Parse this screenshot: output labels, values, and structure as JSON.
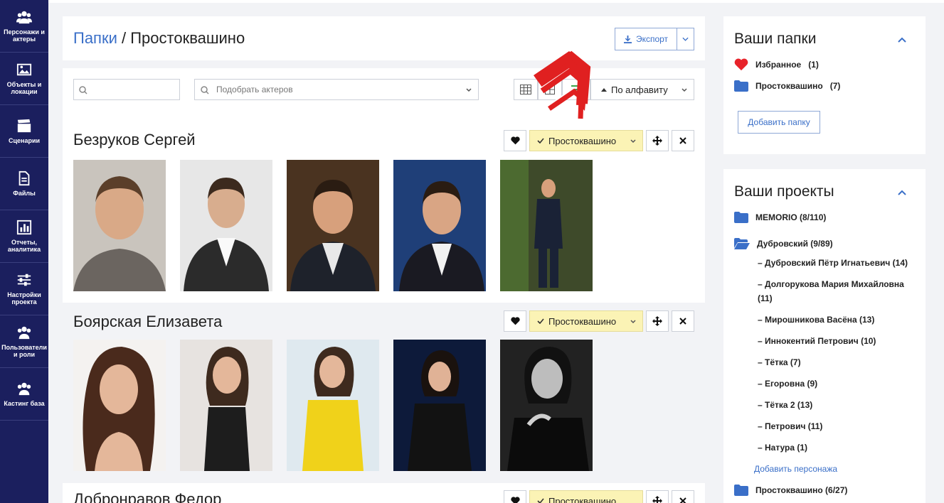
{
  "sidebar": {
    "items": [
      {
        "label": "Персонажи и актеры",
        "icon": "users-icon"
      },
      {
        "label": "Объекты и локации",
        "icon": "image-icon"
      },
      {
        "label": "Сценарии",
        "icon": "clapperboard-icon"
      },
      {
        "label": "Файлы",
        "icon": "file-icon"
      },
      {
        "label": "Отчеты, аналитика",
        "icon": "chart-icon"
      },
      {
        "label": "Настройки проекта",
        "icon": "sliders-icon"
      },
      {
        "label": "Пользователи и роли",
        "icon": "users-icon"
      },
      {
        "label": "Кастинг база",
        "icon": "users-icon"
      }
    ]
  },
  "header": {
    "breadcrumb_link": "Папки",
    "separator": " / ",
    "current": "Простоквашино",
    "export_label": "Экспорт"
  },
  "toolbar": {
    "actor_placeholder": "Подобрать актеров",
    "sort_label": "По алфавиту"
  },
  "actors": [
    {
      "name": "Безруков Сергей",
      "folder": "Простоквашино"
    },
    {
      "name": "Боярская Елизавета",
      "folder": "Простоквашино"
    },
    {
      "name": "Добронравов Федор",
      "folder": "Простоквашино"
    }
  ],
  "folders_panel": {
    "title": "Ваши папки",
    "items": [
      {
        "name": "Избранное",
        "count": "(1)"
      },
      {
        "name": "Простоквашино",
        "count": "(7)"
      }
    ],
    "add_button": "Добавить папку"
  },
  "projects_panel": {
    "title": "Ваши проекты",
    "projects": [
      {
        "name": "MEMORIO (8/110)"
      },
      {
        "name": "Дубровский (9/89)"
      },
      {
        "name": "Простоквашино (6/27)"
      }
    ],
    "characters": [
      "– Дубровский Пётр Игнатьевич (14)",
      "– Долгорукова Мария Михайловна (11)",
      "– Мирошникова Васёна (13)",
      "– Иннокентий Петрович (10)",
      "– Тётка (7)",
      "– Егоровна (9)",
      "– Тётка 2 (13)",
      "– Петрович (11)",
      "– Натура (1)"
    ],
    "add_character": "Добавить персонажа"
  },
  "colors": {
    "sidebar": "#1b1f5e",
    "accent": "#3a6fc8",
    "folder_tag": "#fbf3b5",
    "heart": "#e8232a",
    "arrow": "#e02020"
  }
}
